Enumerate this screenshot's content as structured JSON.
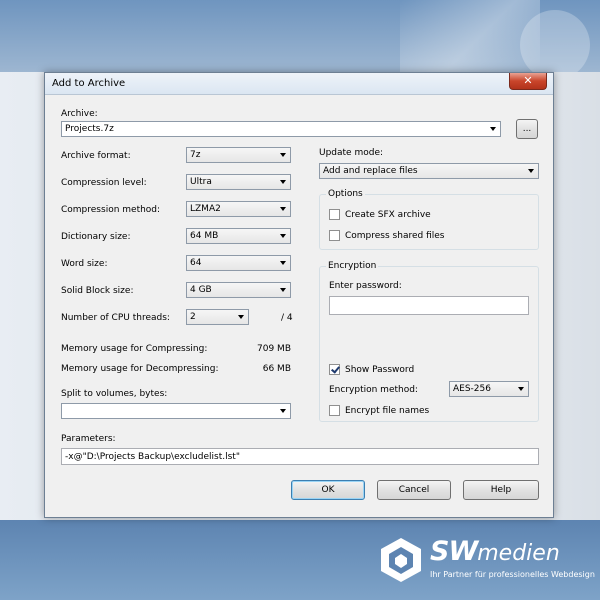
{
  "dialog": {
    "title": "Add to Archive",
    "close_symbol": "✕",
    "archive_label": "Archive:",
    "archive_value": "Projects.7z",
    "browse_label": "...",
    "archive_format_label": "Archive format:",
    "archive_format_value": "7z",
    "compression_level_label": "Compression level:",
    "compression_level_value": "Ultra",
    "compression_method_label": "Compression method:",
    "compression_method_value": "LZMA2",
    "dictionary_size_label": "Dictionary size:",
    "dictionary_size_value": "64 MB",
    "word_size_label": "Word size:",
    "word_size_value": "64",
    "solid_block_label": "Solid Block size:",
    "solid_block_value": "4 GB",
    "cpu_threads_label": "Number of CPU threads:",
    "cpu_threads_value": "2",
    "cpu_threads_max": "/ 4",
    "mem_compress_label": "Memory usage for Compressing:",
    "mem_compress_value": "709 MB",
    "mem_decompress_label": "Memory usage for Decompressing:",
    "mem_decompress_value": "66 MB",
    "split_label": "Split to volumes, bytes:",
    "split_value": "",
    "parameters_label": "Parameters:",
    "parameters_value": "-x@\"D:\\Projects Backup\\excludelist.lst\"",
    "update_mode_label": "Update mode:",
    "update_mode_value": "Add and replace files",
    "options_title": "Options",
    "create_sfx_label": "Create SFX archive",
    "compress_shared_label": "Compress shared files",
    "encryption_title": "Encryption",
    "enter_password_label": "Enter password:",
    "password_value": "",
    "show_password_label": "Show Password",
    "encryption_method_label": "Encryption method:",
    "encryption_method_value": "AES-256",
    "encrypt_names_label": "Encrypt file names",
    "ok_label": "OK",
    "cancel_label": "Cancel",
    "help_label": "Help"
  },
  "checkboxes": {
    "create_sfx": false,
    "compress_shared": false,
    "show_password": true,
    "encrypt_names": false
  },
  "brand": {
    "name_bold": "SW",
    "name_rest": "medien",
    "tagline": "Ihr Partner für professionelles Webdesign"
  },
  "icons": {
    "close": "close-icon",
    "dropdown": "chevron-down-icon",
    "logo": "hexagon-logo-icon"
  },
  "colors": {
    "close_button": "#c9452b",
    "brand_blue": "#5d84b1",
    "default_button_border": "#3c7fb1"
  }
}
